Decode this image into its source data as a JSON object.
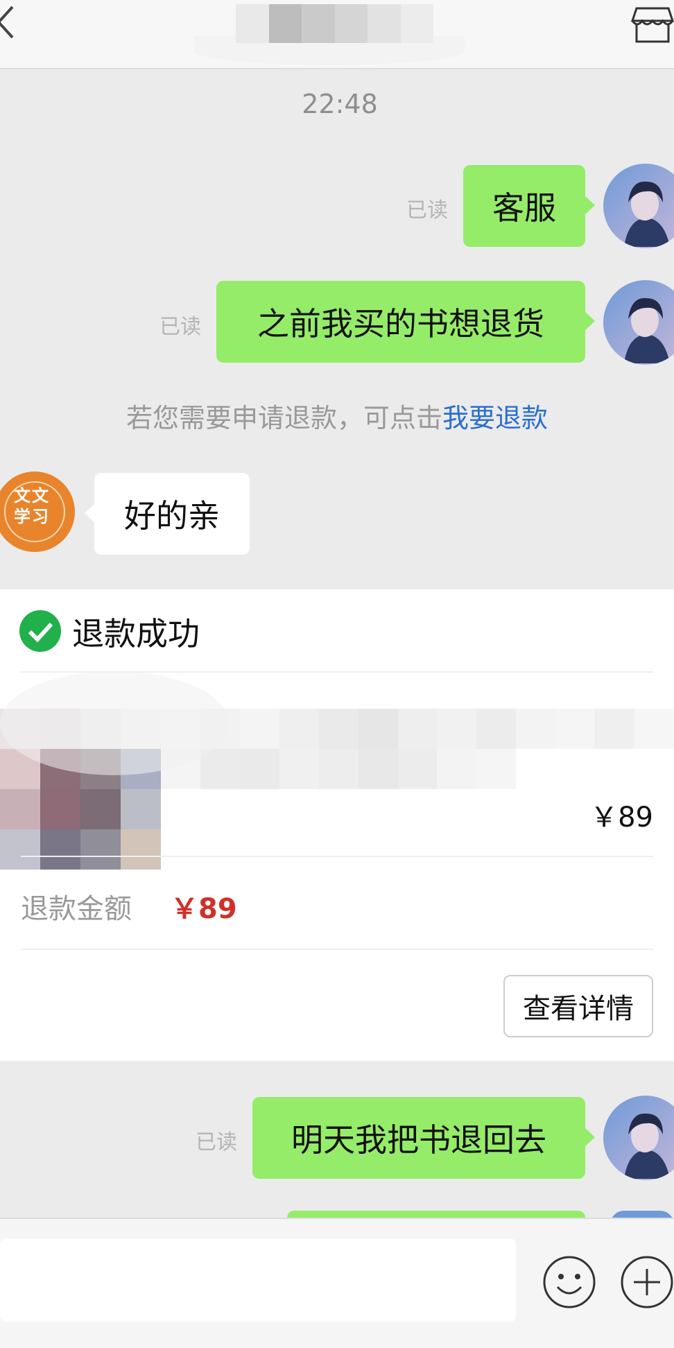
{
  "header": {
    "title_blur_colors": [
      "#e9e9e9",
      "#bdbdbd",
      "#cacaca",
      "#d5d5d5",
      "#e2e2e2",
      "#ececec"
    ]
  },
  "chat": {
    "timestamp": "22:48",
    "messages": [
      {
        "text": "客服",
        "status": "已读"
      },
      {
        "text": "之前我买的书想退货",
        "status": "已读"
      }
    ],
    "system_notice": {
      "prefix": "若您需要申请退款，可点击",
      "link": "我要退款"
    },
    "shop_avatar_text": "文文学习",
    "shop_reply": "好的亲",
    "later_messages": [
      {
        "text": "明天我把书退回去",
        "status": "已读"
      }
    ]
  },
  "refund_card": {
    "title": "退款成功",
    "price": "￥89",
    "refund_label": "退款金额",
    "refund_amount": "￥89",
    "detail_button": "查看详情",
    "thumb_colors": [
      "#eae4e6",
      "#e8e2e4",
      "#eeeeee",
      "#f3f3f3",
      "#ddc7c9",
      "#8c6e78",
      "#8d7f86",
      "#a8aec4",
      "#c7b1b7",
      "#8f6a77",
      "#7b6c75",
      "#bbbdc7",
      "#c2c3cd",
      "#7a7587",
      "#8f8e99",
      "#d2c4b8"
    ],
    "product_blur_colors": [
      "#f6f6f6",
      "#f2f2f2",
      "#f4f4f4",
      "#efefef",
      "#eaeaea",
      "#e6e6e6",
      "#eeeeee",
      "#f1f1f1",
      "#ececec",
      "#f3f3f3",
      "#f5f5f5",
      "#efefef",
      "#f6f6f6",
      "#f4f4f4",
      "#ebebeb",
      "#eaeaea",
      "#f0f0f0",
      "#ededed",
      "#e8e8e8",
      "#ececec",
      "#f3f3f3",
      "#f5f5f5",
      "#ffffff",
      "#ffffff",
      "#ffffff",
      "#ffffff"
    ]
  },
  "colors": {
    "bubble_green": "#95ec69",
    "link_blue": "#2a6fce",
    "refund_red": "#d0302a",
    "check_green": "#21b04b"
  }
}
